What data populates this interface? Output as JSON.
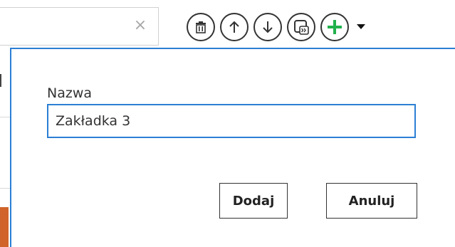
{
  "search": {
    "value": "",
    "clear_glyph": "×"
  },
  "toolbar": {
    "buttons": [
      {
        "name": "delete",
        "icon": "trash-icon"
      },
      {
        "name": "move-up",
        "icon": "arrow-up-icon"
      },
      {
        "name": "move-down",
        "icon": "arrow-down-icon"
      },
      {
        "name": "move-to",
        "icon": "move-to-icon"
      },
      {
        "name": "add",
        "icon": "plus-icon",
        "color": "#22b14c"
      }
    ],
    "dropdown_icon": "caret-down-icon"
  },
  "dialog": {
    "field_label": "Nazwa",
    "field_value": "Zakładka 3",
    "add_label": "Dodaj",
    "cancel_label": "Anuluj"
  },
  "colors": {
    "accent": "#2b7fd4",
    "add_green": "#22b14c",
    "icon_dark": "#333333",
    "side_accent": "#d0642a"
  }
}
